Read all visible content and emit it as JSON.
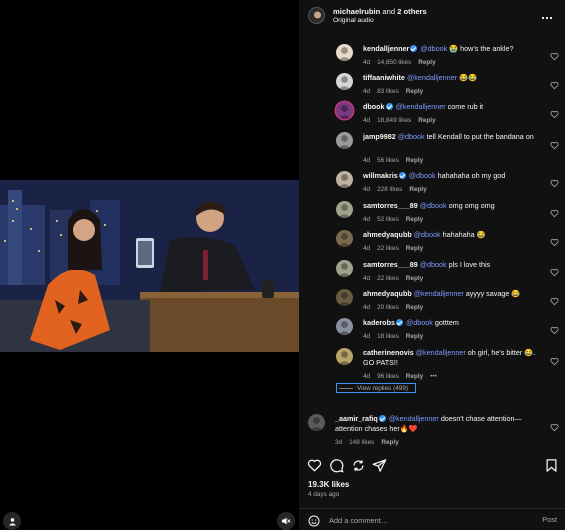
{
  "header": {
    "user": "michaelrubin",
    "connector": "and",
    "others": "2 others",
    "subtitle": "Original audio",
    "more_icon": "more-horizontal-icon"
  },
  "comments": [
    {
      "user": "kendalljenner",
      "verified": true,
      "mention": "@dbook",
      "text": "😭 how's the ankle?",
      "age": "4d",
      "likes": "14,850 likes",
      "reply": "Reply"
    },
    {
      "user": "tiffaaniwhite",
      "verified": false,
      "mention": "@kendalljenner",
      "text": "😂😂",
      "age": "4d",
      "likes": "83 likes",
      "reply": "Reply"
    },
    {
      "user": "dbook",
      "verified": true,
      "mention": "@kendalljenner",
      "text": "come rub it",
      "age": "4d",
      "likes": "18,849 likes",
      "reply": "Reply"
    },
    {
      "user": "jamp9982",
      "verified": false,
      "mention": "@dbook",
      "text": "tell Kendall to put the bandana on",
      "age": "4d",
      "likes": "56 likes",
      "reply": "Reply"
    },
    {
      "user": "willmakris",
      "verified": true,
      "mention": "@dbook",
      "text": "hahahaha oh my god",
      "age": "4d",
      "likes": "228 likes",
      "reply": "Reply"
    },
    {
      "user": "samtorres___89",
      "verified": false,
      "mention": "@dbook",
      "text": "omg omg omg",
      "age": "4d",
      "likes": "52 likes",
      "reply": "Reply"
    },
    {
      "user": "ahmedyaqubb",
      "verified": false,
      "mention": "@dbook",
      "text": "hahahaha 😂",
      "age": "4d",
      "likes": "22 likes",
      "reply": "Reply"
    },
    {
      "user": "samtorres___89",
      "verified": false,
      "mention": "@dbook",
      "text": "pls I love this",
      "age": "4d",
      "likes": "22 likes",
      "reply": "Reply"
    },
    {
      "user": "ahmedyaqubb",
      "verified": false,
      "mention": "@kendalljenner",
      "text": "ayyyy savage 😂",
      "age": "4d",
      "likes": "20 likes",
      "reply": "Reply"
    },
    {
      "user": "kaderobs",
      "verified": true,
      "mention": "@dbook",
      "text": "gotttem",
      "age": "4d",
      "likes": "18 likes",
      "reply": "Reply"
    },
    {
      "user": "catherinenovis",
      "verified": false,
      "mention": "@kendalljenner",
      "text": "oh girl, he's bitter 😂. GO PATS!!",
      "age": "4d",
      "likes": "96 likes",
      "reply": "Reply",
      "more": "•••"
    },
    {
      "user": "_aamir_rafiq",
      "verified": true,
      "mention": "@kendalljenner",
      "text": "doesn't chase attention—attention chases her🔥❤️",
      "age": "3d",
      "likes": "148 likes",
      "reply": "Reply"
    }
  ],
  "view_replies": "View replies (499)",
  "post": {
    "likes": "19.3K likes",
    "posted": "4 days ago"
  },
  "composer": {
    "placeholder": "Add a comment…",
    "post_label": "Post"
  },
  "icons": {
    "like": "heart-icon",
    "comment": "comment-bubble-icon",
    "repost": "repost-icon",
    "share": "paper-plane-icon",
    "save": "bookmark-icon",
    "emoji": "emoji-smile-icon",
    "user_tag": "user-tag-icon",
    "mute": "speaker-muted-icon"
  },
  "colors": {
    "background": "#000000",
    "panel": "#111111",
    "mention": "#7d9bff",
    "verified": "#3897f0",
    "muted_text": "#a8a8a8"
  }
}
